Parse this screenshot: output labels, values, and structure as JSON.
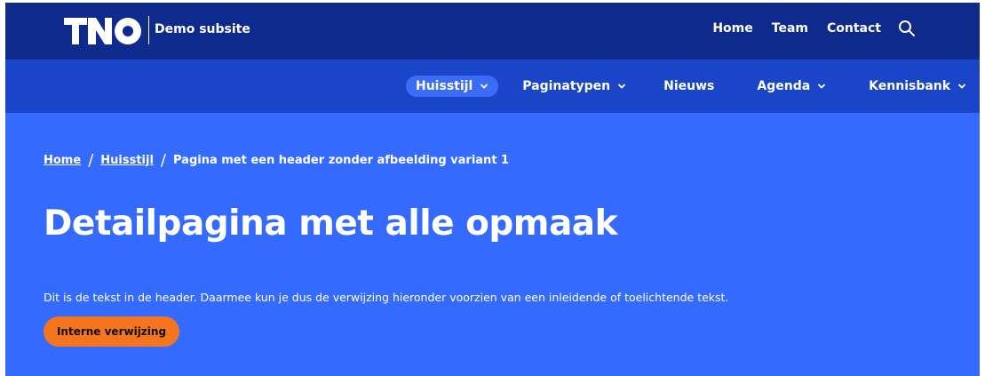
{
  "header": {
    "logo_text": "TNO",
    "subsite": "Demo subsite",
    "top_links": [
      "Home",
      "Team",
      "Contact"
    ],
    "search_icon": "search-icon"
  },
  "main_nav": {
    "items": [
      {
        "label": "Huisstijl",
        "has_dropdown": true,
        "active": true
      },
      {
        "label": "Paginatypen",
        "has_dropdown": true,
        "active": false
      },
      {
        "label": "Nieuws",
        "has_dropdown": false,
        "active": false
      },
      {
        "label": "Agenda",
        "has_dropdown": true,
        "active": false
      },
      {
        "label": "Kennisbank",
        "has_dropdown": true,
        "active": false
      }
    ]
  },
  "hero": {
    "breadcrumb": {
      "home": "Home",
      "section": "Huisstijl",
      "current": "Pagina met een header zonder afbeelding variant 1",
      "separator": "/"
    },
    "title": "Detailpagina met alle opmaak",
    "intro": "Dit is de tekst in de header. Daarmee kun je dus de verwijzing hieronder voorzien van een inleidende of toelichtende tekst.",
    "cta_label": "Interne verwijzing"
  },
  "colors": {
    "topbar": "#0d2a8c",
    "mainnav": "#1a45c8",
    "hero": "#346bfe",
    "active_pill": "#3b6cf5",
    "cta": "#f5751e"
  }
}
